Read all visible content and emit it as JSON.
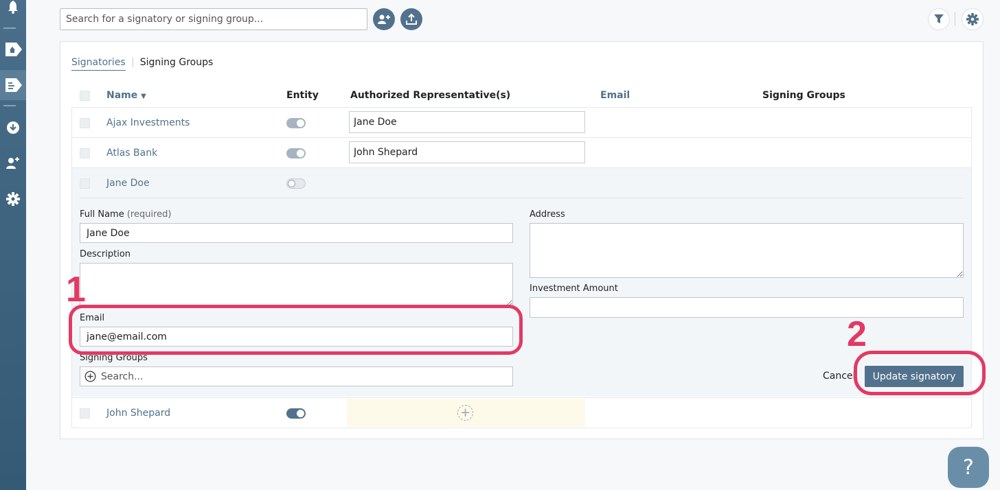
{
  "toolbar": {
    "search_placeholder": "Search for a signatory or signing group..."
  },
  "tabs": [
    {
      "label": "Signatories",
      "active": true
    },
    {
      "label": "Signing Groups",
      "active": false
    }
  ],
  "table": {
    "headers": {
      "name": "Name",
      "entity": "Entity",
      "reps": "Authorized Representative(s)",
      "email": "Email",
      "groups": "Signing Groups"
    },
    "rows": [
      {
        "name": "Ajax Investments",
        "entity": "on",
        "rep": "Jane Doe"
      },
      {
        "name": "Atlas Bank",
        "entity": "on",
        "rep": "John Shepard"
      },
      {
        "name": "Jane Doe",
        "entity": "off",
        "rep": ""
      },
      {
        "name": "John Shepard",
        "entity": "on",
        "rep": ""
      }
    ]
  },
  "edit_form": {
    "full_name_label": "Full Name",
    "full_name_req": "(required)",
    "full_name_value": "Jane Doe",
    "description_label": "Description",
    "description_value": "",
    "email_label": "Email",
    "email_value": "jane@email.com",
    "signing_groups_label": "Signing Groups",
    "signing_groups_placeholder": "Search...",
    "address_label": "Address",
    "address_value": "",
    "investment_label": "Investment Amount",
    "investment_value": "",
    "cancel_label": "Cancel",
    "update_label": "Update signatory"
  },
  "annotations": {
    "step1": "1",
    "step2": "2"
  },
  "help": {
    "label": "?"
  },
  "colors": {
    "accent": "#52718c",
    "annotation": "#e23a63",
    "sidebar": "#3f6580"
  }
}
